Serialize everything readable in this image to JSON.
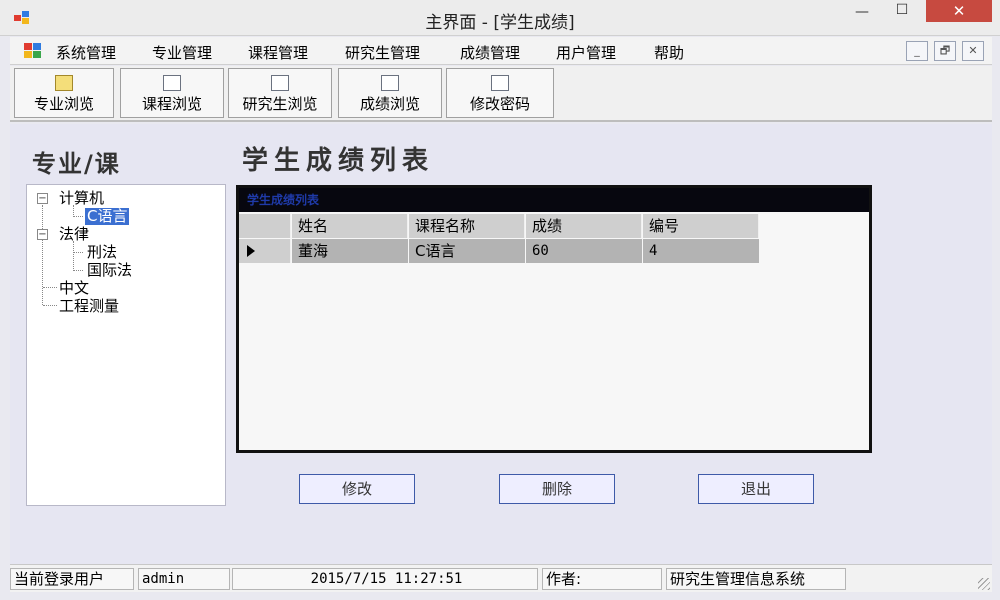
{
  "window": {
    "title": "主界面 - [学生成绩]",
    "close_glyph": "✕",
    "min_glyph": "—",
    "max_glyph": "☐"
  },
  "menu": {
    "items": [
      "系统管理",
      "专业管理",
      "课程管理",
      "研究生管理",
      "成绩管理",
      "用户管理",
      "帮助"
    ],
    "mdi": {
      "min": "_",
      "restore": "🗗",
      "close": "✕"
    }
  },
  "toolbar": {
    "buttons": [
      {
        "label": "专业浏览",
        "icon": "folder-icon"
      },
      {
        "label": "课程浏览",
        "icon": "document-icon"
      },
      {
        "label": "研究生浏览",
        "icon": "book-icon"
      },
      {
        "label": "成绩浏览",
        "icon": "copy-icon"
      },
      {
        "label": "修改密码",
        "icon": "key-icon"
      }
    ]
  },
  "left_panel": {
    "title": "专业/课",
    "tree": {
      "expand_glyph": "−",
      "nodes": [
        {
          "label": "计算机",
          "children": [
            {
              "label": "C语言",
              "selected": true
            }
          ]
        },
        {
          "label": "法律",
          "children": [
            {
              "label": "刑法"
            },
            {
              "label": "国际法"
            }
          ]
        },
        {
          "label": "中文"
        },
        {
          "label": "工程测量"
        }
      ]
    }
  },
  "grades": {
    "title": "学生成绩列表",
    "caption": "学生成绩列表",
    "columns": [
      "姓名",
      "课程名称",
      "成绩",
      "编号"
    ],
    "rows": [
      [
        "董海",
        "C语言",
        "60",
        "4"
      ]
    ]
  },
  "actions": {
    "edit": "修改",
    "delete": "删除",
    "exit": "退出"
  },
  "status": {
    "user_label": "当前登录用户",
    "user": "admin",
    "datetime": "2015/7/15 11:27:51",
    "author_label": "作者:",
    "system": "研究生管理信息系统"
  },
  "colors": {
    "close_button": "#c74a40",
    "selection": "#3b6fd1",
    "grid_caption_bg": "#07070f"
  }
}
